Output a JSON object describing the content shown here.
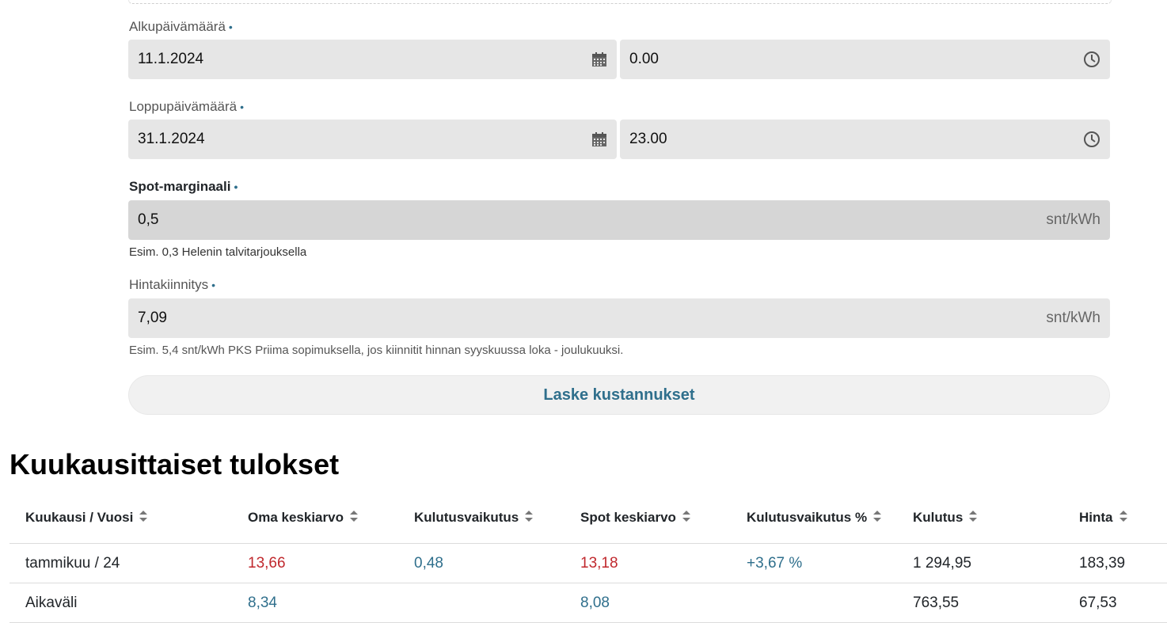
{
  "form": {
    "start": {
      "label": "Alkupäivämäärä",
      "date": "11.1.2024",
      "time": "0.00"
    },
    "end": {
      "label": "Loppupäivämäärä",
      "date": "31.1.2024",
      "time": "23.00"
    },
    "margin": {
      "label": "Spot-marginaali",
      "value": "0,5",
      "unit": "snt/kWh",
      "help": "Esim. 0,3 Helenin talvitarjouksella"
    },
    "fixed": {
      "label": "Hintakiinnitys",
      "value": "7,09",
      "unit": "snt/kWh",
      "help": "Esim. 5,4 snt/kWh PKS Priima sopimuksella, jos kiinnitit hinnan syyskuussa loka - joulukuuksi."
    },
    "required_dot": "•",
    "submit_label": "Laske kustannukset"
  },
  "results": {
    "title": "Kuukausittaiset tulokset",
    "columns": [
      "Kuukausi / Vuosi",
      "Oma keskiarvo",
      "Kulutusvaikutus",
      "Spot keskiarvo",
      "Kulutusvaikutus %",
      "Kulutus",
      "Hinta"
    ],
    "rows": [
      [
        "tammikuu / 24",
        "13,66",
        "0,48",
        "13,18",
        "+3,67 %",
        "1 294,95",
        "183,39"
      ],
      [
        "Aikaväli",
        "8,34",
        "",
        "8,08",
        "",
        "763,55",
        "67,53"
      ]
    ]
  },
  "colors": {
    "accent": "#2f6f8c",
    "negative": "#c0282d",
    "field_bg": "#e6e6e6"
  }
}
